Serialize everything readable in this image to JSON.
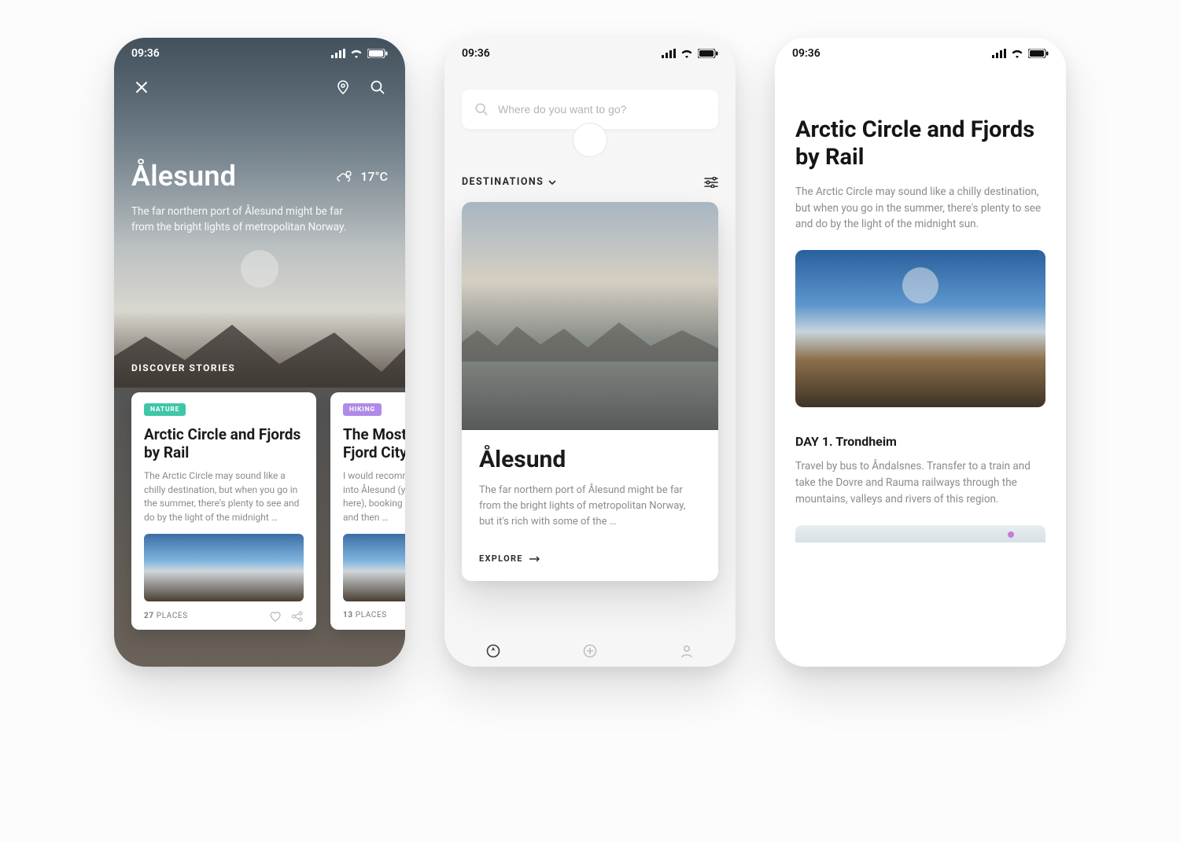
{
  "status": {
    "time": "09:36"
  },
  "screen1": {
    "hero": {
      "title": "Ålesund",
      "temp": "17°C",
      "description": "The far northern port of Ålesund might be far from the bright lights of metropolitan Norway."
    },
    "discover_label": "DISCOVER STORIES",
    "cards": [
      {
        "tag": "NATURE",
        "title": "Arctic Circle and Fjords by Rail",
        "desc": "The Arctic Circle may sound like a chilly destination, but when you go in the summer, there's plenty to see and do by the light of the midnight …",
        "places_count": "27",
        "places_label": "PLACES"
      },
      {
        "tag": "HIKING",
        "title": "The Most Beautiful Fjord City",
        "desc": "I would recommend flying straight into Ålesund (you'll find cheap flights here), booking an Airbnb in Ålesund, and then …",
        "places_count": "13",
        "places_label": "PLACES"
      }
    ]
  },
  "screen2": {
    "search_placeholder": "Where do you want to go?",
    "section_label": "DESTINATIONS",
    "card": {
      "title": "Ålesund",
      "desc": "The far northern port of Ålesund might be far from the bright lights of metropolitan Norway, but it's rich with some of the …",
      "explore_label": "EXPLORE"
    }
  },
  "screen3": {
    "title": "Arctic Circle and Fjords by Rail",
    "desc": "The Arctic Circle may sound like a chilly destination, but when you go in the summer, there's plenty to see and do by the light of the midnight sun.",
    "day_heading": "DAY 1. Trondheim",
    "day_desc": "Travel by bus to Åndalsnes. Transfer to a train and take the Dovre and Rauma railways through the mountains, valleys and rivers of this region."
  }
}
